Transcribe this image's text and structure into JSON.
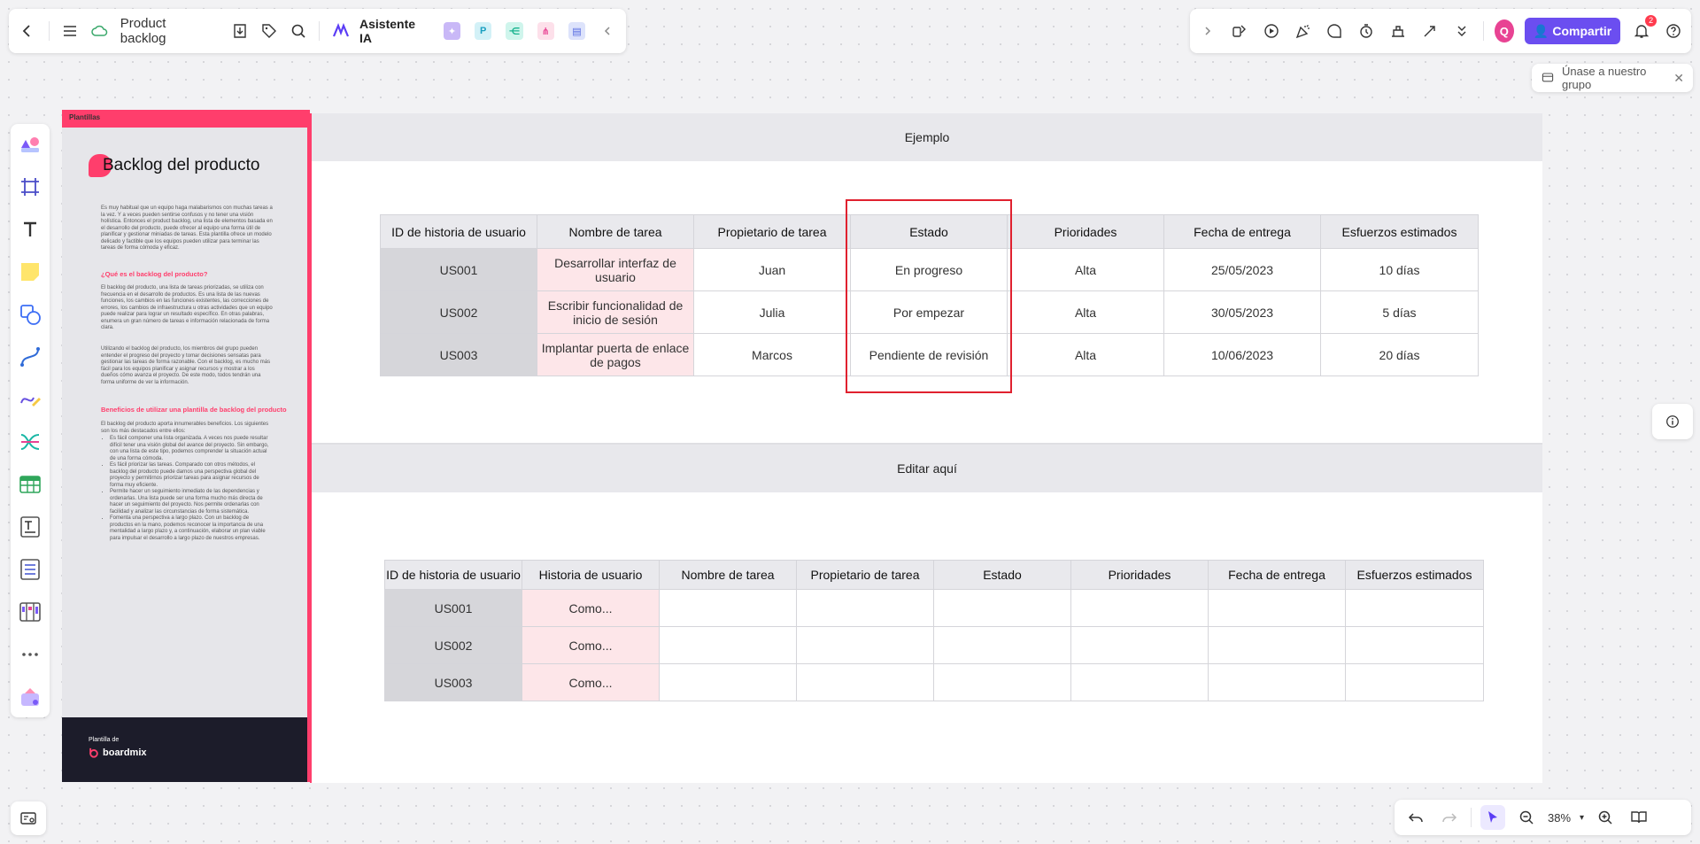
{
  "toolbar": {
    "doc_title": "Product backlog",
    "ai_label": "Asistente IA"
  },
  "topright": {
    "share_label": "Compartir",
    "avatar_letter": "Q",
    "notifications": "2"
  },
  "join_group": "Únase a nuestro grupo",
  "template_sheet": {
    "tag": "Plantillas",
    "title": "Backlog del producto",
    "intro": "Es muy habitual que un equipo haga malabarismos con muchas tareas a la vez. Y a veces pueden sentirse confusos y no tener una visión holística. Entonces el product backlog, una lista de elementos basada en el desarrollo del producto, puede ofrecer al equipo una forma útil de planificar y gestionar miniadas de tareas. Esta plantilla ofrece un modelo delicado y factible que los equipos pueden utilizar para terminar las tareas de forma cómoda y eficaz.",
    "heading1": "¿Qué es el backlog del producto?",
    "para1": "El backlog del producto, una lista de tareas priorizadas, se utiliza con frecuencia en el desarrollo de productos. Es una lista de las nuevas funciones, los cambios en las funciones existentes, las correcciones de errores, los cambios de infraestructura u otras actividades que un equipo puede realizar para lograr un resultado específico. En otras palabras, enumera un gran número de tareas e información relacionada de forma clara.",
    "para2": "Utilizando el backlog del producto, los miembros del grupo pueden entender el progreso del proyecto y tomar decisiones sensatas para gestionar las tareas de forma razonable. Con el backlog, es mucho más fácil para los equipos planificar y asignar recursos y mostrar a los dueños cómo avanza el proyecto. De este modo, todos tendrán una forma uniforme de ver la información.",
    "heading2": "Beneficios de utilizar una plantilla de backlog del producto",
    "para3": "El backlog del producto aporta innumerables beneficios. Los siguientes son los más destacados entre ellos:",
    "bullets": [
      "Es fácil componer una lista organizada. A veces nos puede resultar difícil tener una visión global del avance del proyecto. Sin embargo, con una lista de este tipo, podemos comprender la situación actual de una forma cómoda.",
      "Es fácil priorizar las tareas. Comparado con otros métodos, el backlog del producto puede darnos una perspectiva global del proyecto y permitirnos priorizar tareas para asignar recursos de forma muy eficiente.",
      "Permite hacer un seguimiento inmediato de las dependencias y ordenarlas. Una lista puede ser una forma mucho más directa de hacer un seguimiento del proyecto. Nos permite ordenarlas con facilidad y analizar las circunstancias de forma sistemática.",
      "Fomenta una perspectiva a largo plazo. Con un backlog de productos en la mano, podemos reconocer la importancia de una mentalidad a largo plazo y, a continuación, elaborar un plan viable para impulsar el desarrollo a largo plazo de nuestros empresas."
    ],
    "footer_small": "Plantilla de",
    "footer_brand": "boardmix"
  },
  "board": {
    "example_title": "Ejemplo",
    "edit_title": "Editar aquí",
    "table1": {
      "headers": [
        "ID de historia de usuario",
        "Nombre de tarea",
        "Propietario de tarea",
        "Estado",
        "Prioridades",
        "Fecha de entrega",
        "Esfuerzos estimados"
      ],
      "rows": [
        [
          "US001",
          "Desarrollar interfaz de usuario",
          "Juan",
          "En progreso",
          "Alta",
          "25/05/2023",
          "10 días"
        ],
        [
          "US002",
          "Escribir funcionalidad de inicio de sesión",
          "Julia",
          "Por empezar",
          "Alta",
          "30/05/2023",
          "5 días"
        ],
        [
          "US003",
          "Implantar puerta de enlace de pagos",
          "Marcos",
          "Pendiente de revisión",
          "Alta",
          "10/06/2023",
          "20 días"
        ]
      ]
    },
    "table2": {
      "headers": [
        "ID de historia de usuario",
        "Historia de usuario",
        "Nombre de tarea",
        "Propietario de tarea",
        "Estado",
        "Prioridades",
        "Fecha de entrega",
        "Esfuerzos estimados"
      ],
      "rows": [
        [
          "US001",
          "Como...",
          "",
          "",
          "",
          "",
          "",
          ""
        ],
        [
          "US002",
          "Como...",
          "",
          "",
          "",
          "",
          "",
          ""
        ],
        [
          "US003",
          "Como...",
          "",
          "",
          "",
          "",
          "",
          ""
        ]
      ]
    }
  },
  "zoom": "38%",
  "colors": {
    "accent_pink": "#ff3e6c",
    "share_purple": "#6b4ef0",
    "highlight_red": "#e0212f"
  }
}
